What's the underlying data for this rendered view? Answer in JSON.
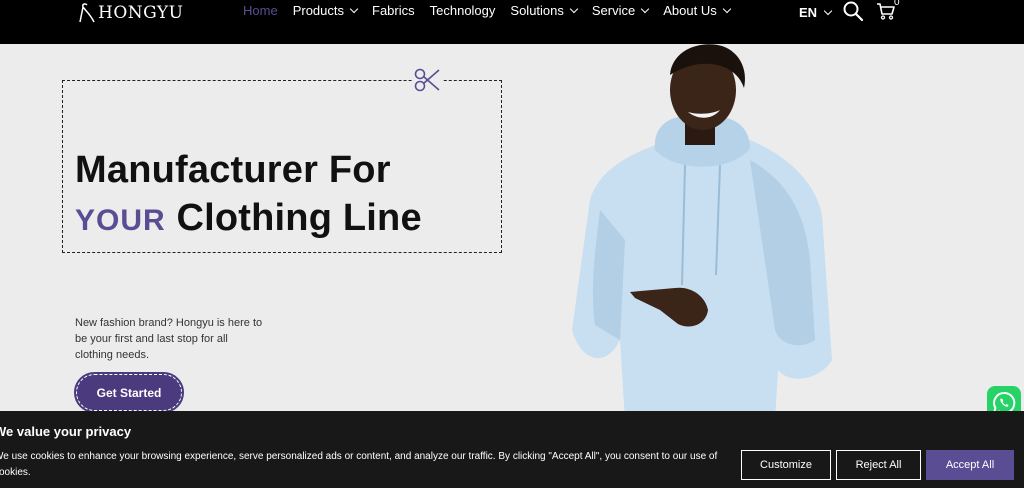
{
  "brand": {
    "name": "HONGYU"
  },
  "nav": {
    "items": [
      {
        "label": "Home",
        "active": true,
        "dropdown": false
      },
      {
        "label": "Products",
        "active": false,
        "dropdown": true
      },
      {
        "label": "Fabrics",
        "active": false,
        "dropdown": false
      },
      {
        "label": "Technology",
        "active": false,
        "dropdown": false
      },
      {
        "label": "Solutions",
        "active": false,
        "dropdown": true
      },
      {
        "label": "Service",
        "active": false,
        "dropdown": true
      },
      {
        "label": "About Us",
        "active": false,
        "dropdown": true
      }
    ],
    "language": "EN",
    "cart_count": "0"
  },
  "hero": {
    "headline_line1": "Manufacturer For",
    "headline_accent": "YOUR",
    "headline_line2_rest": "Clothing Line",
    "tagline": "New fashion brand? Hongyu is here to be your first and last stop for all clothing needs.",
    "cta_label": "Get Started"
  },
  "cookie": {
    "title": "We value your privacy",
    "text": "We use cookies to enhance your browsing experience, serve personalized ads or content, and analyze our traffic. By clicking \"Accept All\", you consent to our use of cookies.",
    "customize_label": "Customize",
    "reject_label": "Reject All",
    "accept_label": "Accept All"
  },
  "icons": {
    "logo": "hanger-logo-icon",
    "search": "search-icon",
    "cart": "cart-icon",
    "scissors": "scissors-icon",
    "whatsapp": "whatsapp-icon"
  },
  "colors": {
    "accent": "#5b4d94",
    "header_bg": "#000000",
    "page_bg": "#ececec",
    "cookie_bg": "#181818",
    "whatsapp": "#25d366"
  }
}
